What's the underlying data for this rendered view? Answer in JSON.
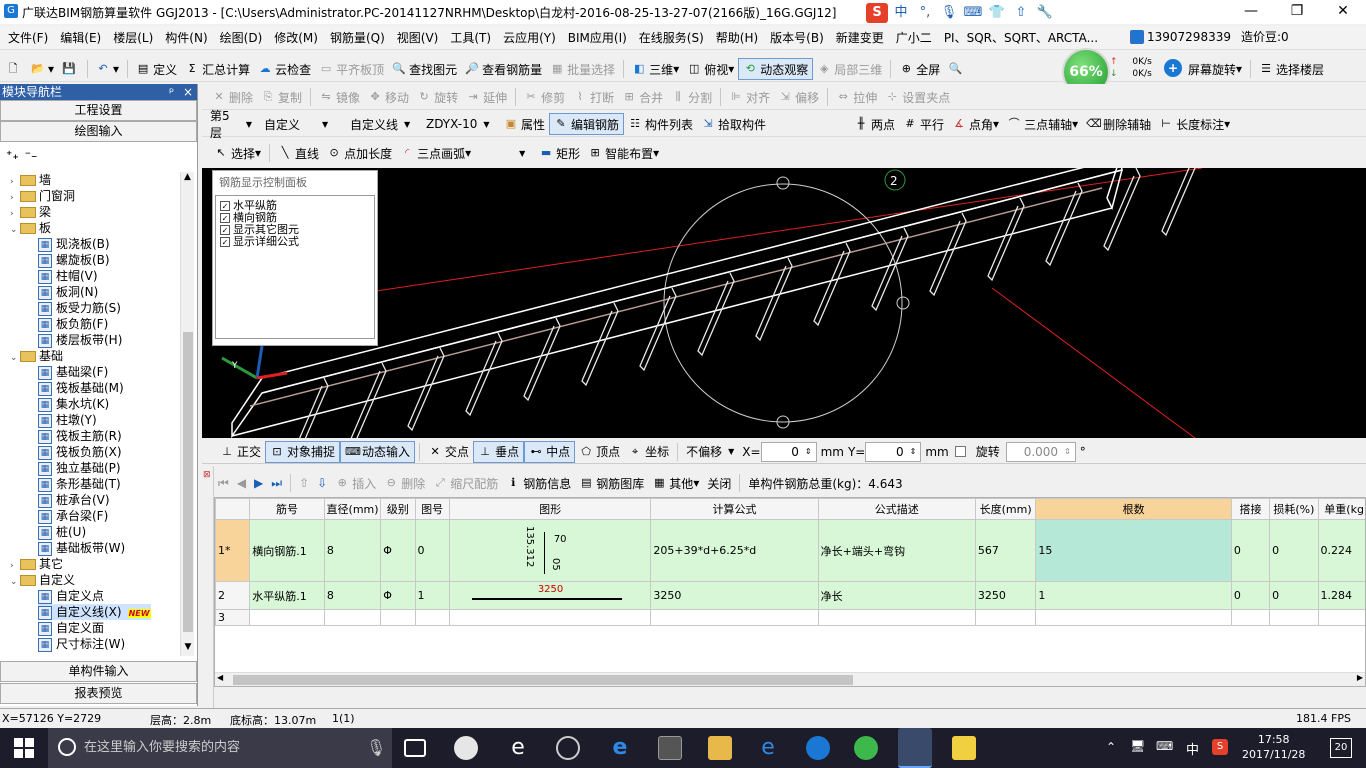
{
  "window": {
    "title": "广联达BIM钢筋算量软件 GGJ2013 - [C:\\Users\\Administrator.PC-20141127NRHM\\Desktop\\白龙村-2016-08-25-13-27-07(2166版)_16G.GGJ12]",
    "minimize": "—",
    "maximize": "❐",
    "close": "✕"
  },
  "ime": {
    "label": "中"
  },
  "menu": [
    "文件(F)",
    "编辑(E)",
    "楼层(L)",
    "构件(N)",
    "绘图(D)",
    "修改(M)",
    "钢筋量(Q)",
    "视图(V)",
    "工具(T)",
    "云应用(Y)",
    "BIM应用(I)",
    "在线服务(S)",
    "帮助(H)",
    "版本号(B)",
    "新建变更",
    "广小二",
    "PI、SQR、SQRT、ARCTA..."
  ],
  "account": {
    "phone": "13907298339",
    "coins": "造价豆:0"
  },
  "toolbar1": {
    "items": [
      "定义",
      "汇总计算",
      "云检查",
      "平齐板顶",
      "查找图元",
      "查看钢筋量",
      "批量选择",
      "三维",
      "俯视",
      "动态观察",
      "局部三维",
      "全屏",
      "屏幕旋转",
      "选择楼层"
    ],
    "perf_percent": "66%",
    "net_up": "0K/s",
    "net_down": "0K/s"
  },
  "toolbar2": [
    "删除",
    "复制",
    "镜像",
    "移动",
    "旋转",
    "延伸",
    "修剪",
    "打断",
    "合并",
    "分割",
    "对齐",
    "偏移",
    "拉伸",
    "设置夹点"
  ],
  "toolbar3": {
    "floor": "第5层",
    "category": "自定义",
    "subcategory": "自定义线",
    "element": "ZDYX-10",
    "buttons": [
      "属性",
      "编辑钢筋",
      "构件列表",
      "拾取构件"
    ],
    "right": [
      "两点",
      "平行",
      "点角",
      "三点辅轴",
      "删除辅轴",
      "长度标注"
    ]
  },
  "toolbar4": [
    "选择",
    "直线",
    "点加长度",
    "三点画弧",
    "矩形",
    "智能布置"
  ],
  "sidebar": {
    "header": "模块导航栏",
    "pin": "ᵖ",
    "close": "×",
    "btn_project": "工程设置",
    "btn_draw": "绘图输入",
    "btn_single": "单构件输入",
    "btn_report": "报表预览",
    "tree": [
      {
        "label": "墙",
        "type": "folder",
        "exp": "›"
      },
      {
        "label": "门窗洞",
        "type": "folder",
        "exp": "›"
      },
      {
        "label": "梁",
        "type": "folder",
        "exp": "›"
      },
      {
        "label": "板",
        "type": "folder",
        "exp": "⌄"
      },
      {
        "label": "现浇板(B)",
        "type": "leaf"
      },
      {
        "label": "螺旋板(B)",
        "type": "leaf"
      },
      {
        "label": "柱帽(V)",
        "type": "leaf"
      },
      {
        "label": "板洞(N)",
        "type": "leaf"
      },
      {
        "label": "板受力筋(S)",
        "type": "leaf"
      },
      {
        "label": "板负筋(F)",
        "type": "leaf"
      },
      {
        "label": "楼层板带(H)",
        "type": "leaf"
      },
      {
        "label": "基础",
        "type": "folder",
        "exp": "⌄"
      },
      {
        "label": "基础梁(F)",
        "type": "leaf"
      },
      {
        "label": "筏板基础(M)",
        "type": "leaf"
      },
      {
        "label": "集水坑(K)",
        "type": "leaf"
      },
      {
        "label": "柱墩(Y)",
        "type": "leaf"
      },
      {
        "label": "筏板主筋(R)",
        "type": "leaf"
      },
      {
        "label": "筏板负筋(X)",
        "type": "leaf"
      },
      {
        "label": "独立基础(P)",
        "type": "leaf"
      },
      {
        "label": "条形基础(T)",
        "type": "leaf"
      },
      {
        "label": "桩承台(V)",
        "type": "leaf"
      },
      {
        "label": "承台梁(F)",
        "type": "leaf"
      },
      {
        "label": "桩(U)",
        "type": "leaf"
      },
      {
        "label": "基础板带(W)",
        "type": "leaf"
      },
      {
        "label": "其它",
        "type": "folder",
        "exp": "›"
      },
      {
        "label": "自定义",
        "type": "folder",
        "exp": "⌄"
      },
      {
        "label": "自定义点",
        "type": "leaf"
      },
      {
        "label": "自定义线(X)",
        "type": "leaf"
      },
      {
        "label": "自定义面",
        "type": "leaf"
      },
      {
        "label": "尺寸标注(W)",
        "type": "leaf"
      }
    ],
    "new_badge": "NEW"
  },
  "rebar_panel": {
    "title": "钢筋显示控制面板",
    "options": [
      "水平纵筋",
      "横向钢筋",
      "显示其它图元",
      "显示详细公式"
    ]
  },
  "viewport": {
    "marker": "2"
  },
  "snapbar": {
    "items": [
      "正交",
      "对象捕捉",
      "动态输入",
      "交点",
      "垂点",
      "中点",
      "顶点",
      "坐标"
    ],
    "offset": "不偏移",
    "x_label": "X=",
    "x_value": "0",
    "y_label": "Y=",
    "y_value": "0",
    "unit": "mm",
    "rotate_label": "旋转",
    "rotate_value": "0.000",
    "deg": "°"
  },
  "grid_toolbar": {
    "items": [
      "插入",
      "删除",
      "缩尺配筋",
      "钢筋信息",
      "钢筋图库",
      "其他",
      "关闭"
    ],
    "total": "单构件钢筋总重(kg)：4.643"
  },
  "grid": {
    "headers": [
      "",
      "筋号",
      "直径(mm)",
      "级别",
      "图号",
      "图形",
      "计算公式",
      "公式描述",
      "长度(mm)",
      "根数",
      "搭接",
      "损耗(%)",
      "单重(kg)"
    ],
    "rows": [
      {
        "idx": "1*",
        "name": "横向钢筋.1",
        "dia": "8",
        "grade": "Φ",
        "fig": "0",
        "shape_a": "135.312",
        "shape_b": "70",
        "shape_c": "05",
        "formula": "205+39*d+6.25*d",
        "desc": "净长+端头+弯钩",
        "length": "567",
        "count": "15",
        "lap": "0",
        "loss": "0",
        "weight": "0.224"
      },
      {
        "idx": "2",
        "name": "水平纵筋.1",
        "dia": "8",
        "grade": "Φ",
        "fig": "1",
        "shape_a": "3250",
        "shape_b": "",
        "shape_c": "",
        "formula": "3250",
        "desc": "净长",
        "length": "3250",
        "count": "1",
        "lap": "0",
        "loss": "0",
        "weight": "1.284"
      },
      {
        "idx": "3",
        "name": "",
        "dia": "",
        "grade": "",
        "fig": "",
        "shape_a": "",
        "shape_b": "",
        "shape_c": "",
        "formula": "",
        "desc": "",
        "length": "",
        "count": "",
        "lap": "",
        "loss": "",
        "weight": ""
      }
    ]
  },
  "status": {
    "coords": "X=57126 Y=2729",
    "floor_height": "层高：2.8m",
    "base_height": "底标高：13.07m",
    "layer": "1(1)",
    "fps": "181.4 FPS"
  },
  "taskbar": {
    "search_placeholder": "在这里输入你要搜索的内容",
    "time": "17:58",
    "date": "2017/11/28",
    "lang": "中",
    "notify": "20"
  }
}
